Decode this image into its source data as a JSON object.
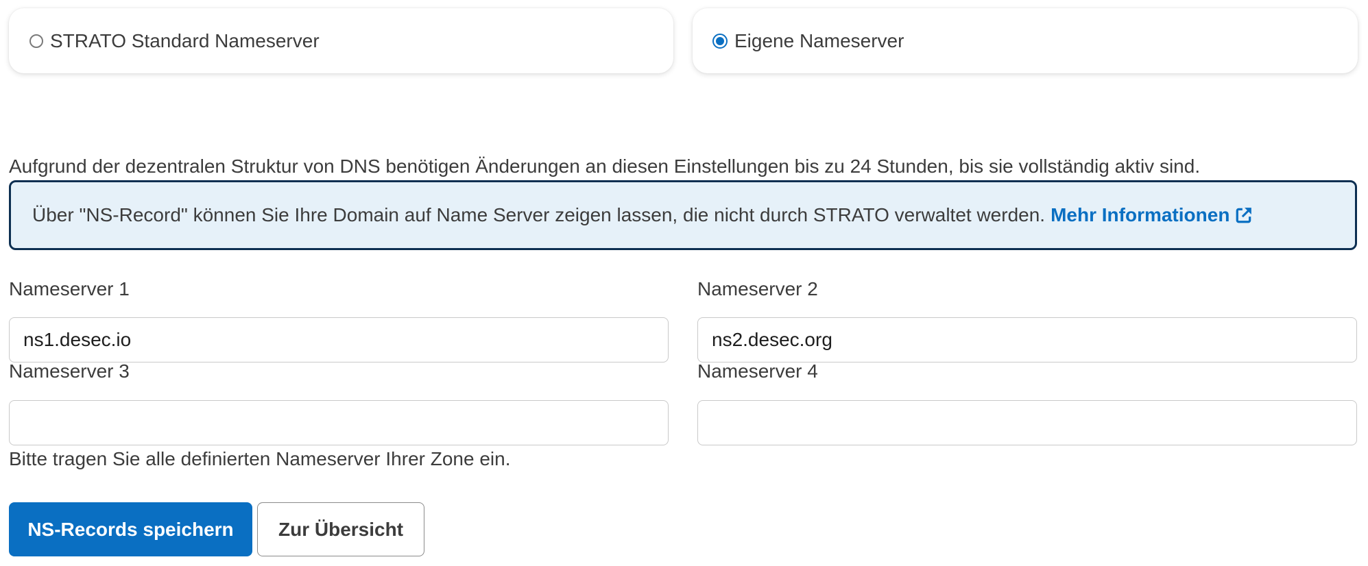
{
  "nameserver_choice": {
    "options": [
      {
        "label": "STRATO Standard Nameserver",
        "selected": false
      },
      {
        "label": "Eigene Nameserver",
        "selected": true
      }
    ]
  },
  "propagation_note": "Aufgrund der dezentralen Struktur von DNS benötigen Änderungen an diesen Einstellungen bis zu 24 Stunden, bis sie vollständig aktiv sind.",
  "info_box": {
    "text": "Über \"NS-Record\" können Sie Ihre Domain auf Name Server zeigen lassen, die nicht durch STRATO verwaltet werden.",
    "link_label": "Mehr Informationen",
    "link_icon": "external-link-icon"
  },
  "fields": [
    {
      "label": "Nameserver 1",
      "value": "ns1.desec.io"
    },
    {
      "label": "Nameserver 2",
      "value": "ns2.desec.org"
    },
    {
      "label": "Nameserver 3",
      "value": ""
    },
    {
      "label": "Nameserver 4",
      "value": ""
    }
  ],
  "help_text": "Bitte tragen Sie alle definierten Nameserver Ihrer Zone ein.",
  "buttons": {
    "save_label": "NS-Records speichern",
    "overview_label": "Zur Übersicht"
  },
  "colors": {
    "accent": "#0a6fc2",
    "info_background": "#e6f1f9",
    "info_border": "#0d2f52",
    "text": "#3c3c3c"
  }
}
